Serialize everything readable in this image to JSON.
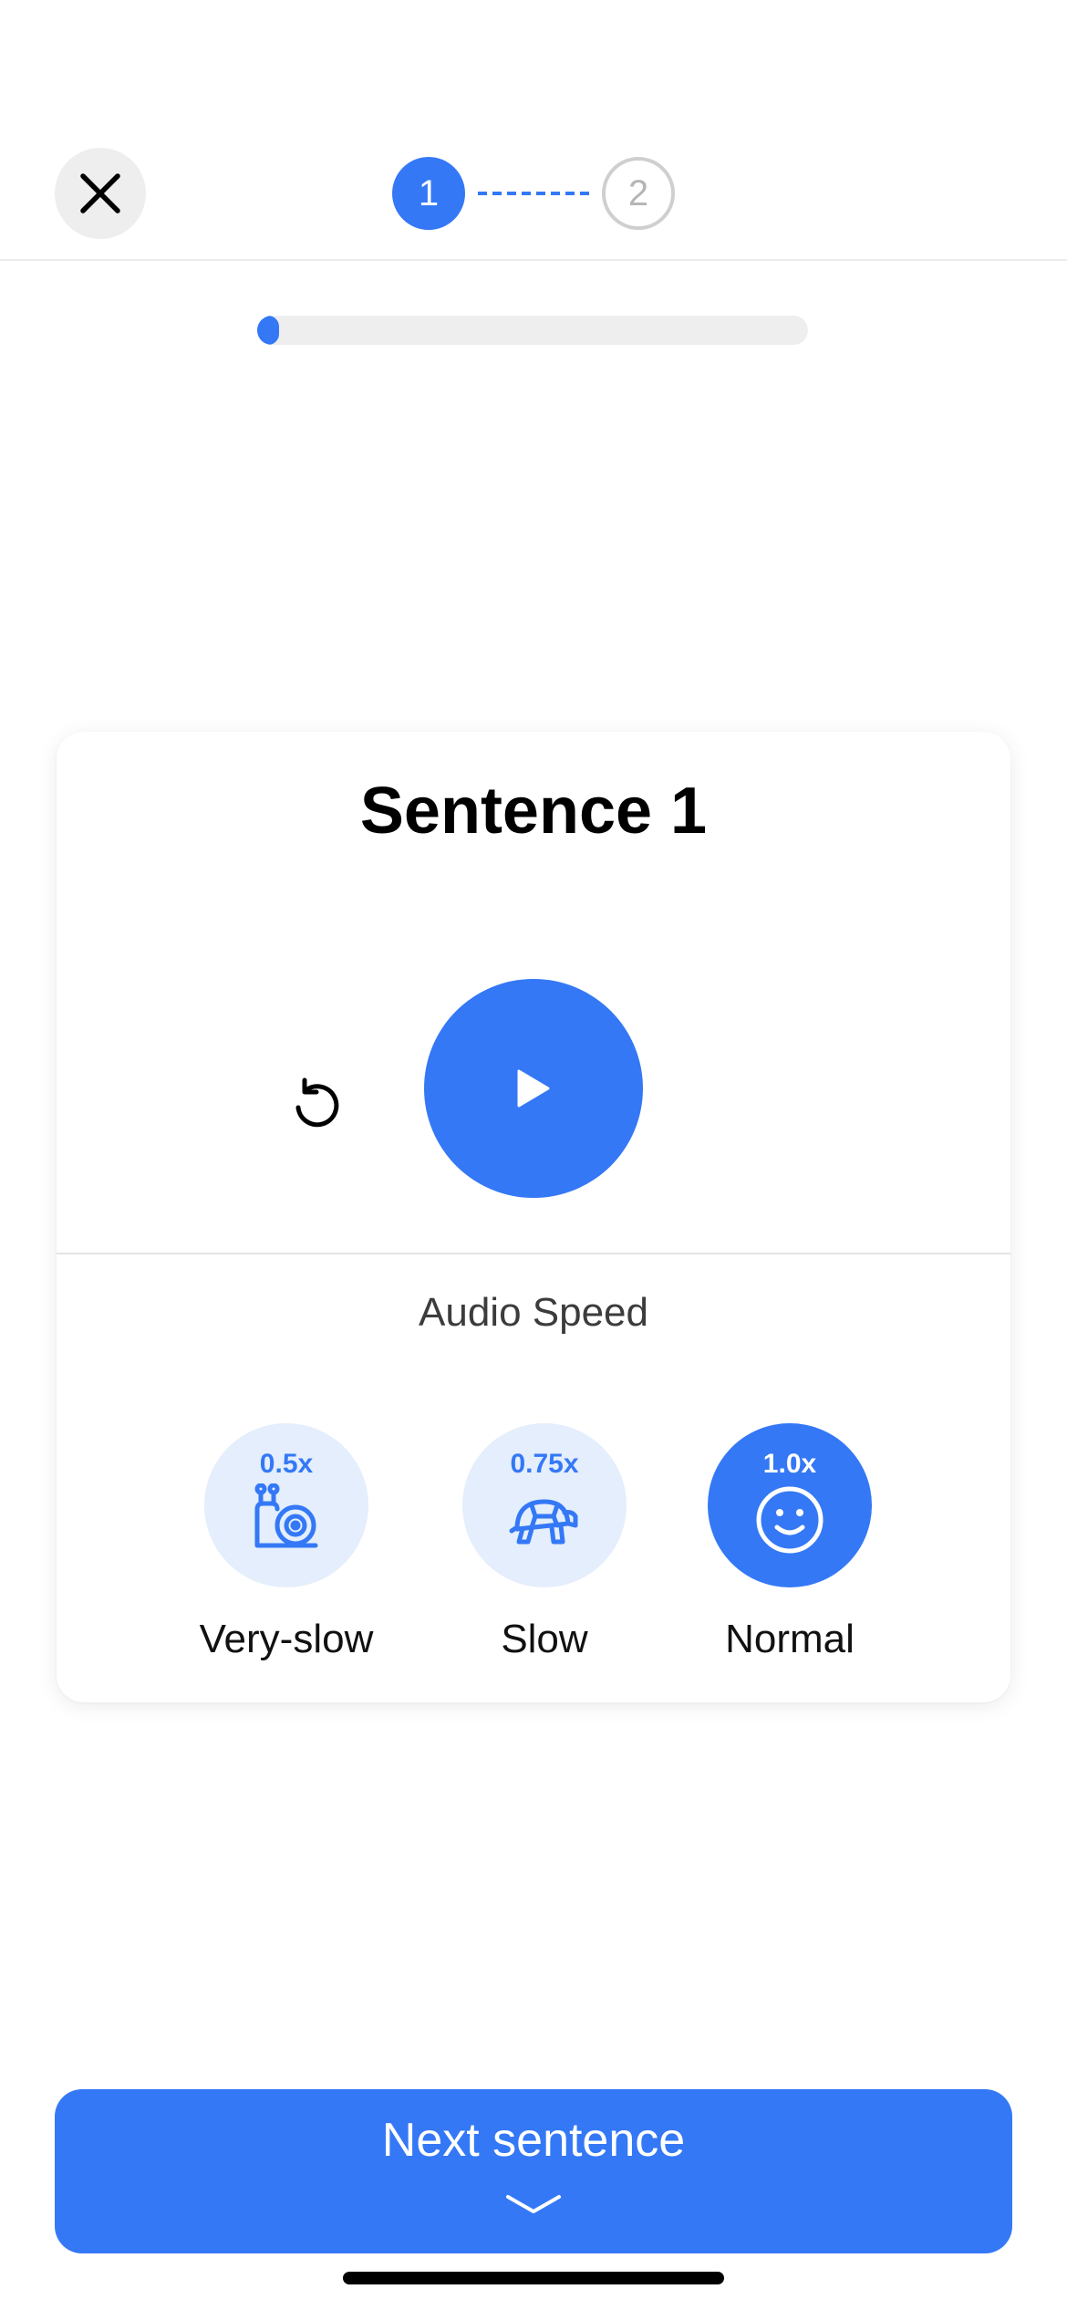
{
  "header": {
    "close_icon": "close-icon",
    "steps": [
      {
        "number": "1",
        "state": "active"
      },
      {
        "number": "2",
        "state": "inactive"
      }
    ],
    "progress": 0.04
  },
  "card": {
    "title": "Sentence 1",
    "replay_icon": "replay-icon",
    "play_icon": "play-icon",
    "speed_heading": "Audio Speed",
    "speeds": [
      {
        "rate": "0.5x",
        "label": "Very-slow",
        "icon": "snail-icon",
        "selected": false
      },
      {
        "rate": "0.75x",
        "label": "Slow",
        "icon": "turtle-icon",
        "selected": false
      },
      {
        "rate": "1.0x",
        "label": "Normal",
        "icon": "smiley-icon",
        "selected": true
      }
    ]
  },
  "footer": {
    "next_label": "Next sentence",
    "chevron_icon": "chevron-down-icon"
  },
  "colors": {
    "accent": "#3478f6",
    "accent_light": "#e4eefc",
    "close_bg": "#eeeeee"
  }
}
